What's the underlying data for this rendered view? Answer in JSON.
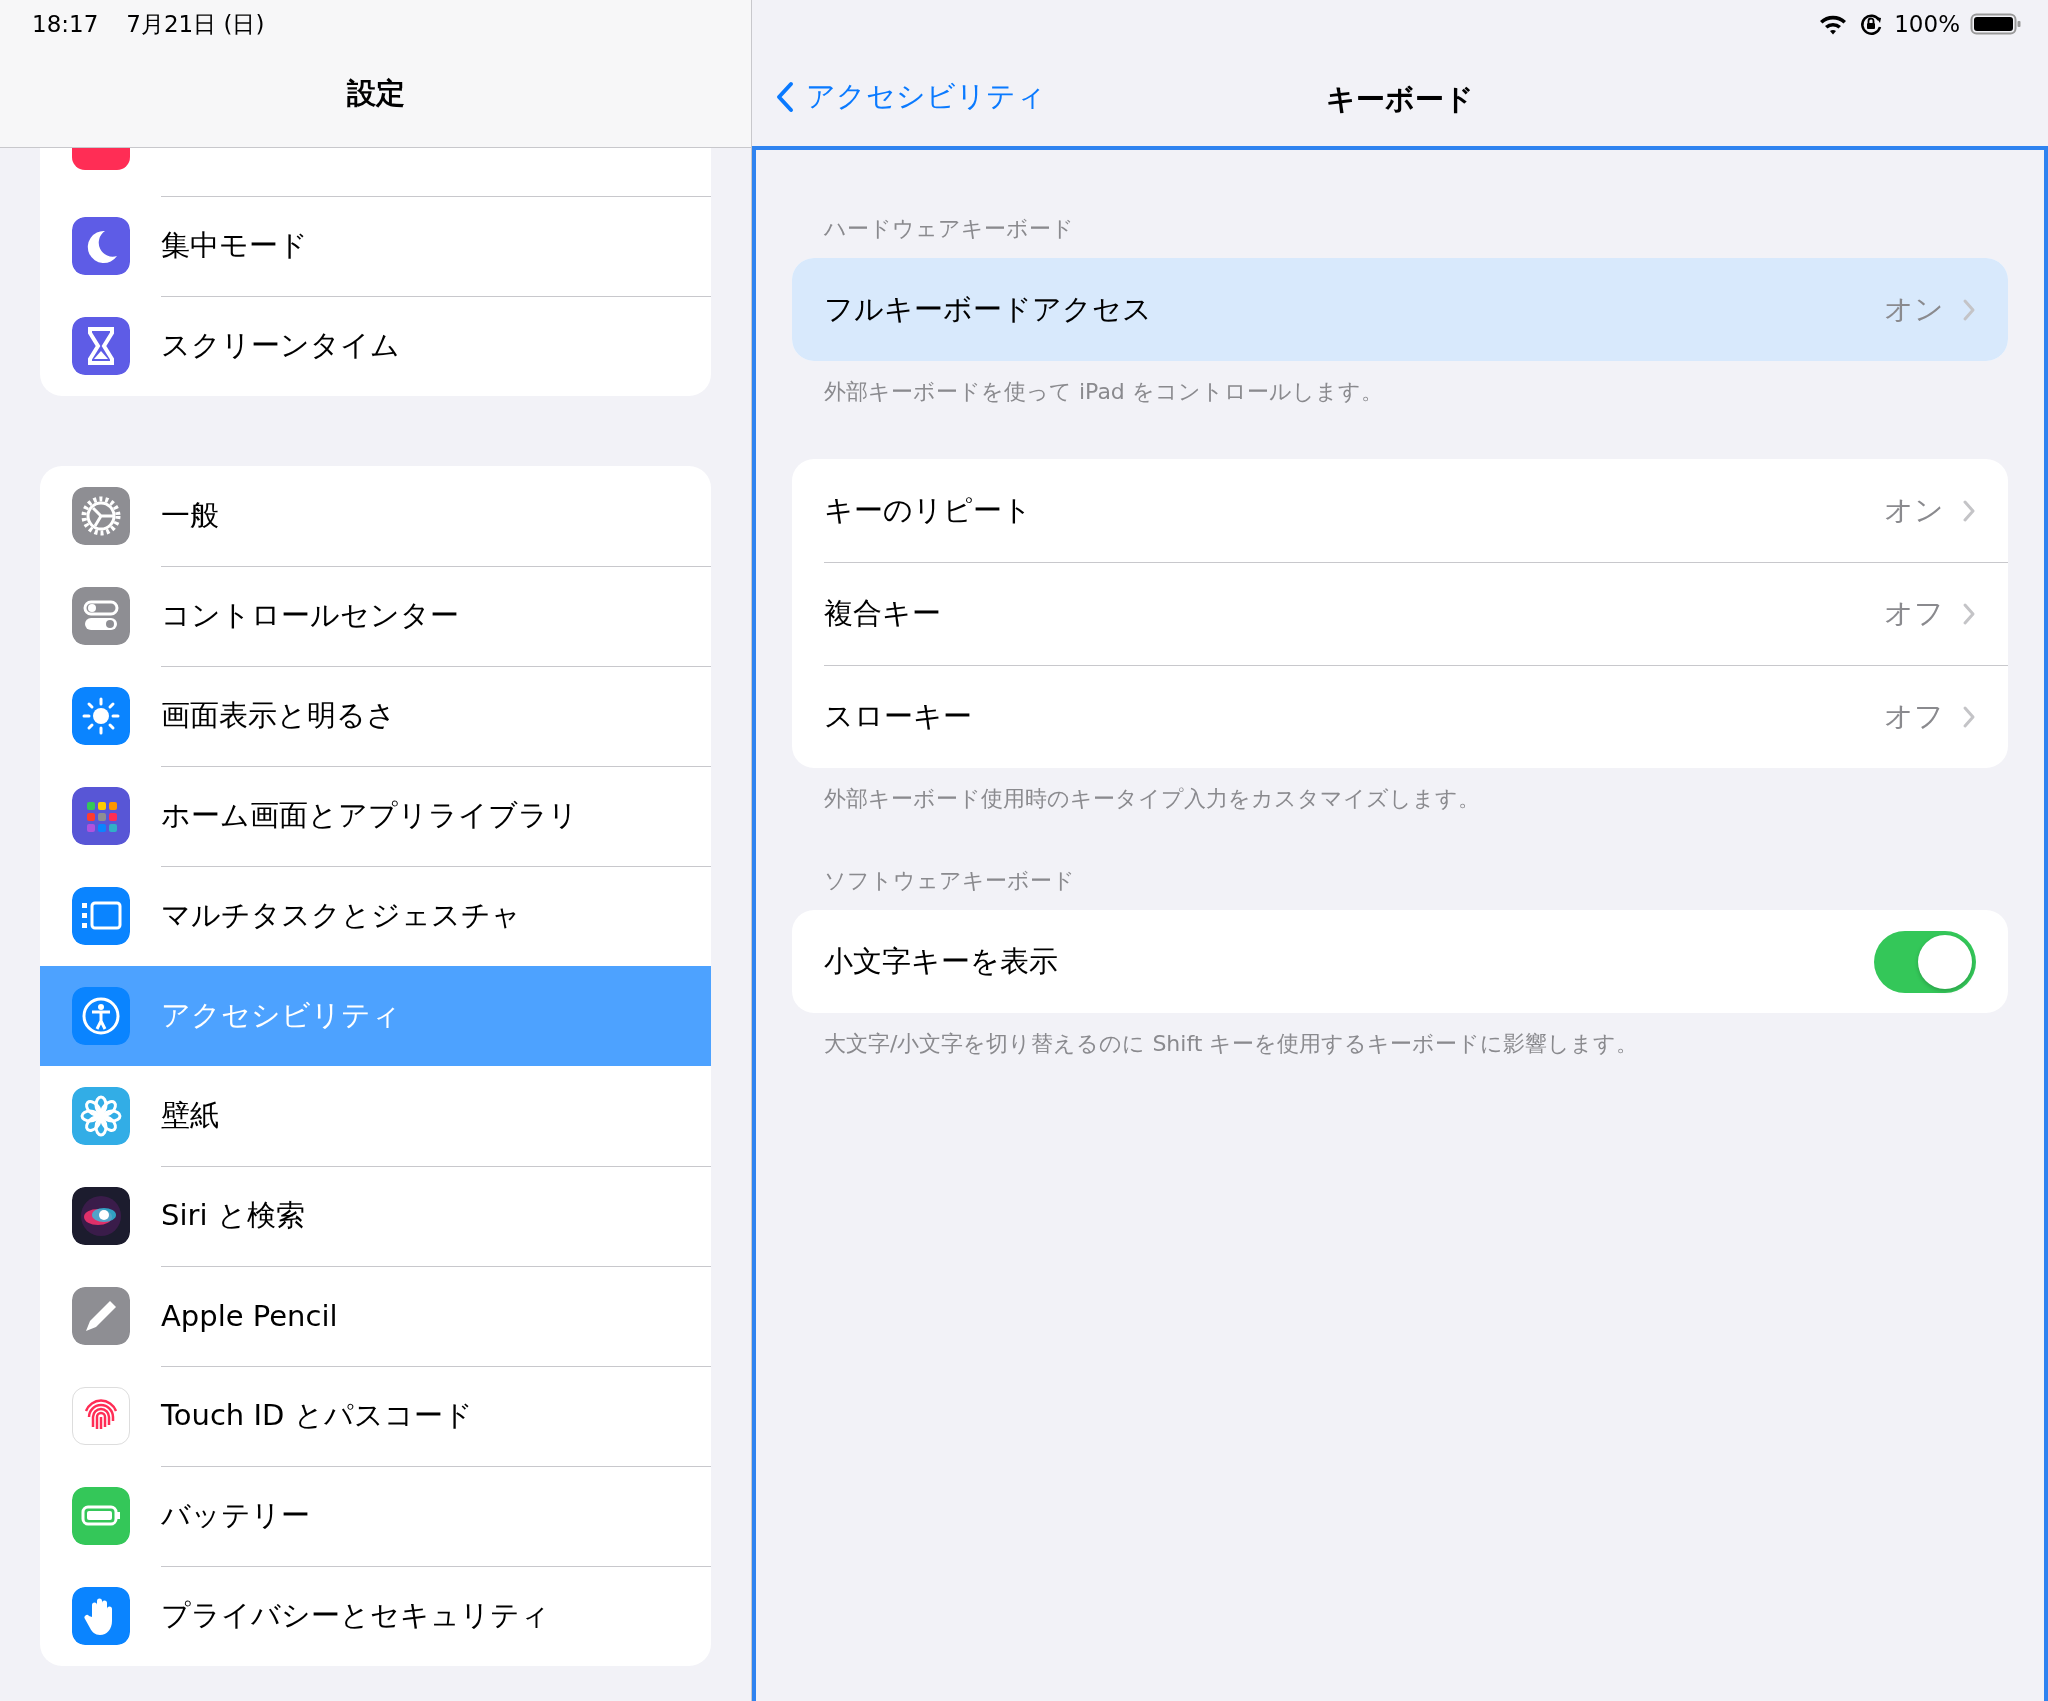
{
  "status_bar": {
    "time": "18:17",
    "date": "7月21日 (日)",
    "battery": "100%"
  },
  "sidebar": {
    "title": "設定",
    "groups": [
      {
        "items": [
          {
            "label": "集中モード",
            "selected": false
          },
          {
            "label": "スクリーンタイム",
            "selected": false
          }
        ]
      },
      {
        "items": [
          {
            "label": "一般",
            "selected": false
          },
          {
            "label": "コントロールセンター",
            "selected": false
          },
          {
            "label": "画面表示と明るさ",
            "selected": false
          },
          {
            "label": "ホーム画面とアプリライブラリ",
            "selected": false
          },
          {
            "label": "マルチタスクとジェスチャ",
            "selected": false
          },
          {
            "label": "アクセシビリティ",
            "selected": true
          },
          {
            "label": "壁紙",
            "selected": false
          },
          {
            "label": "Siri と検索",
            "selected": false
          },
          {
            "label": "Apple Pencil",
            "selected": false
          },
          {
            "label": "Touch ID とパスコード",
            "selected": false
          },
          {
            "label": "バッテリー",
            "selected": false
          },
          {
            "label": "プライバシーとセキュリティ",
            "selected": false
          }
        ]
      }
    ]
  },
  "nav": {
    "back_label": "アクセシビリティ",
    "title": "キーボード"
  },
  "sections": [
    {
      "header": "ハードウェアキーボード",
      "rows": [
        {
          "kind": "link",
          "label": "フルキーボードアクセス",
          "value": "オン",
          "selected": true
        }
      ],
      "footer": "外部キーボードを使って iPad をコントロールします。"
    },
    {
      "rows": [
        {
          "kind": "link",
          "label": "キーのリピート",
          "value": "オン",
          "selected": false
        },
        {
          "kind": "link",
          "label": "複合キー",
          "value": "オフ",
          "selected": false
        },
        {
          "kind": "link",
          "label": "スローキー",
          "value": "オフ",
          "selected": false
        }
      ],
      "footer": "外部キーボード使用時のキータイプ入力をカスタマイズします。"
    },
    {
      "header": "ソフトウェアキーボード",
      "rows": [
        {
          "kind": "toggle",
          "label": "小文字キーを表示",
          "on": true,
          "selected": false
        }
      ],
      "footer": "大文字/小文字を切り替えるのに Shift キーを使用するキーボードに影響します。"
    }
  ]
}
